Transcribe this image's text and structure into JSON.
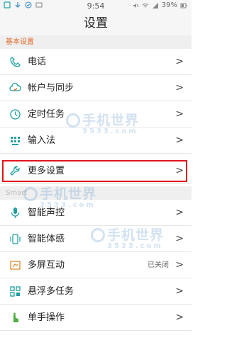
{
  "status_bar": {
    "time": "9:54",
    "battery": "39%"
  },
  "header": {
    "title": "设置"
  },
  "sections": [
    {
      "title": "基本设置"
    },
    {
      "title": "Smart"
    }
  ],
  "rows": [
    {
      "label": "电话",
      "icon": "phone-icon"
    },
    {
      "label": "帐户与同步",
      "icon": "cloud-sync-icon"
    },
    {
      "label": "定时任务",
      "icon": "clock-icon"
    },
    {
      "label": "输入法",
      "icon": "keyboard-icon"
    },
    {
      "label": "更多设置",
      "icon": "wrench-icon"
    },
    {
      "label": "智能声控",
      "icon": "microphone-icon"
    },
    {
      "label": "智能体感",
      "icon": "motion-phone-icon"
    },
    {
      "label": "多屏互动",
      "icon": "multiscreen-icon",
      "status": "已关闭"
    },
    {
      "label": "悬浮多任务",
      "icon": "floating-tasks-icon"
    },
    {
      "label": "单手操作",
      "icon": "one-hand-icon"
    }
  ],
  "chevron": ">",
  "watermark": {
    "text": "手机世界",
    "sub": "3533.com"
  },
  "colors": {
    "accent": "#e06a2a",
    "highlight": "#e2141c",
    "icon": "#1f9fa1"
  }
}
